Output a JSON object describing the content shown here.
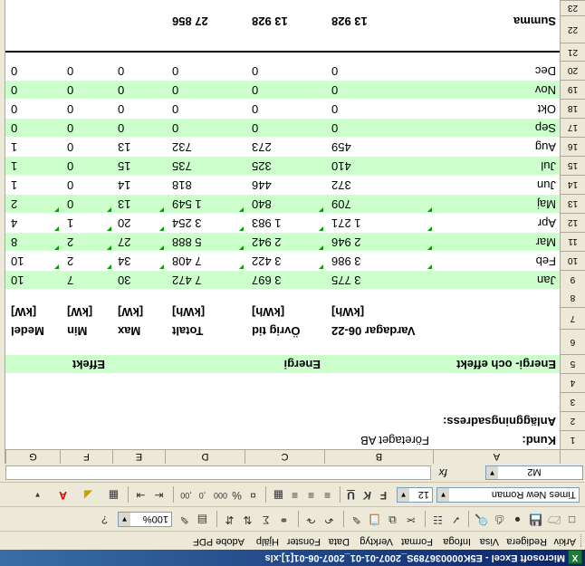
{
  "window": {
    "title": "Microsoft Excel - E5K000036789S_2007-01-01_2007-06-01[1].xls"
  },
  "menu": [
    "Arkiv",
    "Redigera",
    "Visa",
    "Infoga",
    "Format",
    "Verktyg",
    "Data",
    "Fönster",
    "Hjälp",
    "Adobe PDF"
  ],
  "toolbar": {
    "zoom": "100%",
    "font_name": "Times New Roman",
    "font_size": "12"
  },
  "formula_bar": {
    "name_box": "M2",
    "fx": "fx",
    "content": ""
  },
  "columns": [
    "A",
    "B",
    "C",
    "D",
    "E",
    "F",
    "G"
  ],
  "cells": {
    "a1": "Kund:",
    "b1": "Företaget AB",
    "a2": "Anläggningsadress:",
    "a5": "Energi- och effekt",
    "c5": "Energi",
    "f5": "Effekt",
    "headers": [
      "Vardagar 06-22",
      "Övrig tid",
      "Totalt",
      "Max",
      "Min",
      "Medel"
    ],
    "units": [
      "[kWh]",
      "[kWh]",
      "[kWh]",
      "[kW]",
      "[kW]",
      "[kW]"
    ],
    "sum_label": "Summa",
    "sum_values": [
      "13 928",
      "13 928",
      "27 856"
    ]
  },
  "months": [
    {
      "row": "9",
      "name": "Jan",
      "values": [
        "3 775",
        "3 697",
        "7 472",
        "30",
        "7",
        "10"
      ]
    },
    {
      "row": "10",
      "name": "Feb",
      "values": [
        "3 986",
        "3 422",
        "7 408",
        "34",
        "2",
        "10"
      ]
    },
    {
      "row": "11",
      "name": "Mar",
      "values": [
        "2 946",
        "2 942",
        "5 888",
        "27",
        "2",
        "8"
      ]
    },
    {
      "row": "12",
      "name": "Apr",
      "values": [
        "1 271",
        "1 983",
        "3 254",
        "20",
        "1",
        "4"
      ]
    },
    {
      "row": "13",
      "name": "Maj",
      "values": [
        "709",
        "840",
        "1 549",
        "13",
        "0",
        "2"
      ]
    },
    {
      "row": "14",
      "name": "Jun",
      "values": [
        "372",
        "446",
        "818",
        "14",
        "0",
        "1"
      ]
    },
    {
      "row": "15",
      "name": "Jul",
      "values": [
        "410",
        "325",
        "735",
        "15",
        "0",
        "1"
      ]
    },
    {
      "row": "16",
      "name": "Aug",
      "values": [
        "459",
        "273",
        "732",
        "13",
        "0",
        "1"
      ]
    },
    {
      "row": "17",
      "name": "Sep",
      "values": [
        "0",
        "0",
        "0",
        "0",
        "0",
        "0"
      ]
    },
    {
      "row": "18",
      "name": "Okt",
      "values": [
        "0",
        "0",
        "0",
        "0",
        "0",
        "0"
      ]
    },
    {
      "row": "19",
      "name": "Nov",
      "values": [
        "0",
        "0",
        "0",
        "0",
        "0",
        "0"
      ]
    },
    {
      "row": "20",
      "name": "Dec",
      "values": [
        "0",
        "0",
        "0",
        "0",
        "0",
        "0"
      ]
    }
  ],
  "colors": {
    "band": "#ccffcc",
    "titlebar": "#0a246a"
  }
}
